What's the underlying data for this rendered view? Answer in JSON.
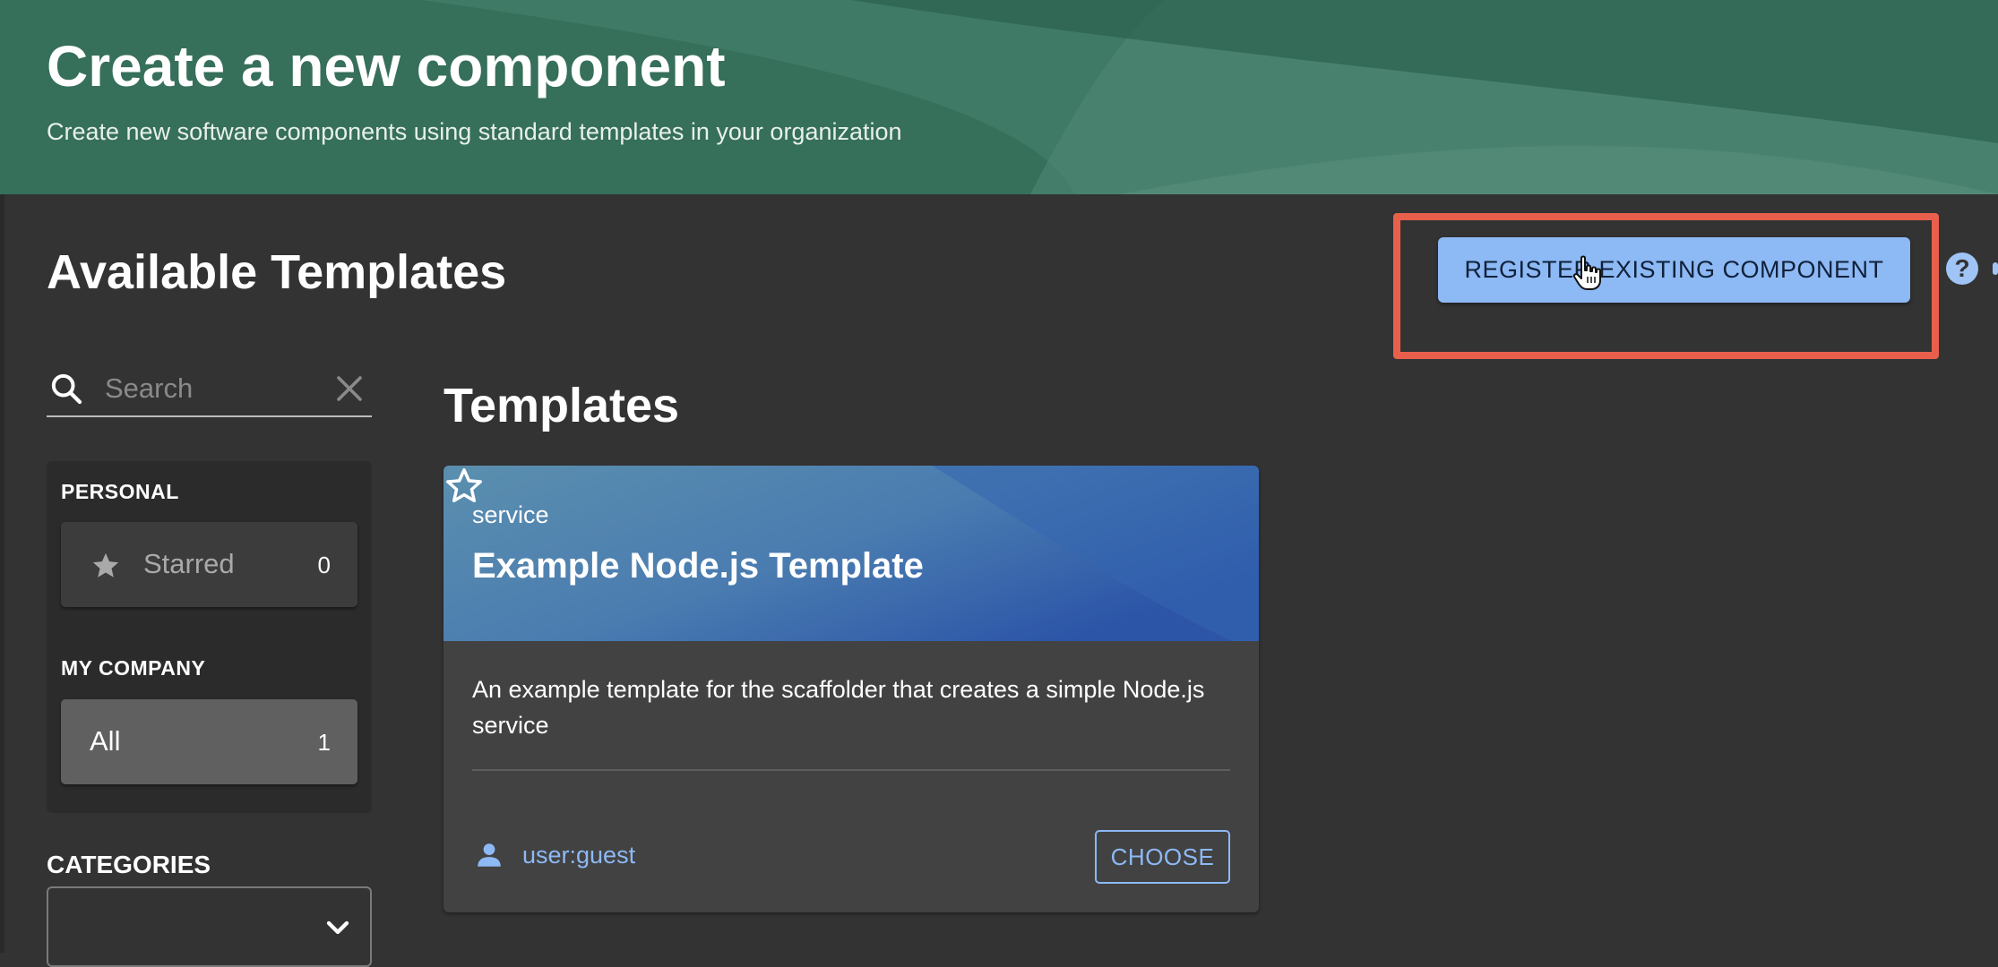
{
  "header": {
    "title": "Create a new component",
    "subtitle": "Create new software components using standard templates in your organization"
  },
  "content_header": {
    "title": "Available Templates",
    "register_button_label": "REGISTER EXISTING COMPONENT",
    "help_icon": "help-circle-icon",
    "highlight_color": "#e8604c"
  },
  "search": {
    "placeholder": "Search",
    "value": ""
  },
  "filters": {
    "personal_heading": "PERSONAL",
    "starred": {
      "label": "Starred",
      "count": "0"
    },
    "company_heading": "MY COMPANY",
    "all": {
      "label": "All",
      "count": "1"
    }
  },
  "categories": {
    "label": "CATEGORIES",
    "selected": ""
  },
  "templates": {
    "heading": "Templates",
    "cards": [
      {
        "type": "service",
        "title": "Example Node.js Template",
        "description": "An example template for the scaffolder that creates a simple Node.js service",
        "owner": "user:guest",
        "action_label": "CHOOSE"
      }
    ]
  },
  "colors": {
    "header_bg": "#3f7a66",
    "page_bg": "#333333",
    "accent": "#8db9f5",
    "card_header_start": "#5b8fae",
    "card_header_end": "#2c55a8"
  }
}
